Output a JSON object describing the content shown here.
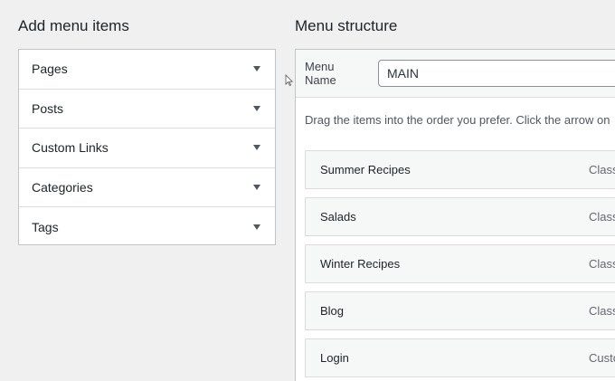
{
  "left": {
    "heading": "Add menu items",
    "accordion": [
      {
        "label": "Pages"
      },
      {
        "label": "Posts"
      },
      {
        "label": "Custom Links"
      },
      {
        "label": "Categories"
      },
      {
        "label": "Tags"
      }
    ]
  },
  "right": {
    "heading": "Menu structure",
    "menu_name_label": "Menu Name",
    "menu_name_value": "MAIN",
    "instructions": "Drag the items into the order you prefer. Click the arrow on",
    "items": [
      {
        "title": "Summer Recipes",
        "type": "Classic"
      },
      {
        "title": "Salads",
        "type": "Classic"
      },
      {
        "title": "Winter Recipes",
        "type": "Classic"
      },
      {
        "title": "Blog",
        "type": "Classic"
      },
      {
        "title": "Login",
        "type": "Custom"
      }
    ]
  },
  "icons": {
    "accordion_toggle": "triangle-down-icon",
    "cursor": "mouse-pointer-icon"
  }
}
